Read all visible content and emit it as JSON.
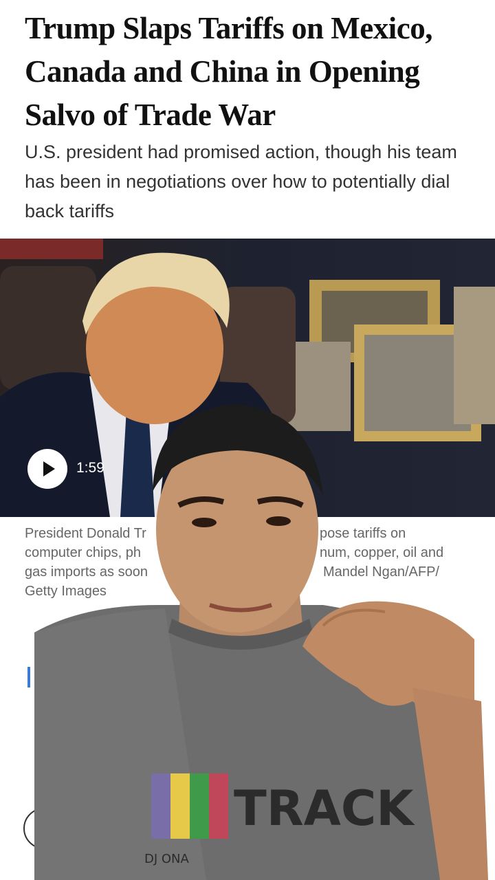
{
  "article": {
    "headline": "Trump Slaps Tariffs on Mexico, Canada and China in Opening Salvo of Trade War",
    "dek": "U.S. president had promised action, though his team has been in negotiations over how to potentially dial back tariffs"
  },
  "video": {
    "duration": "1:59"
  },
  "caption": {
    "part1": "President Donald Tr",
    "part2": "pose tariffs on",
    "part3": "computer chips, ph",
    "part4": "num, copper, oil and",
    "part5": "gas imports as soon",
    "part6": "Mandel Ngan/AFP/",
    "part7": "Getty Images"
  },
  "shirt": {
    "print_text": "TRACK",
    "sub_text": "DJ  ONA"
  },
  "colors": {
    "headline": "#111111",
    "dek": "#333333",
    "caption": "#666666",
    "accent_bar": "#3b7bd1"
  }
}
